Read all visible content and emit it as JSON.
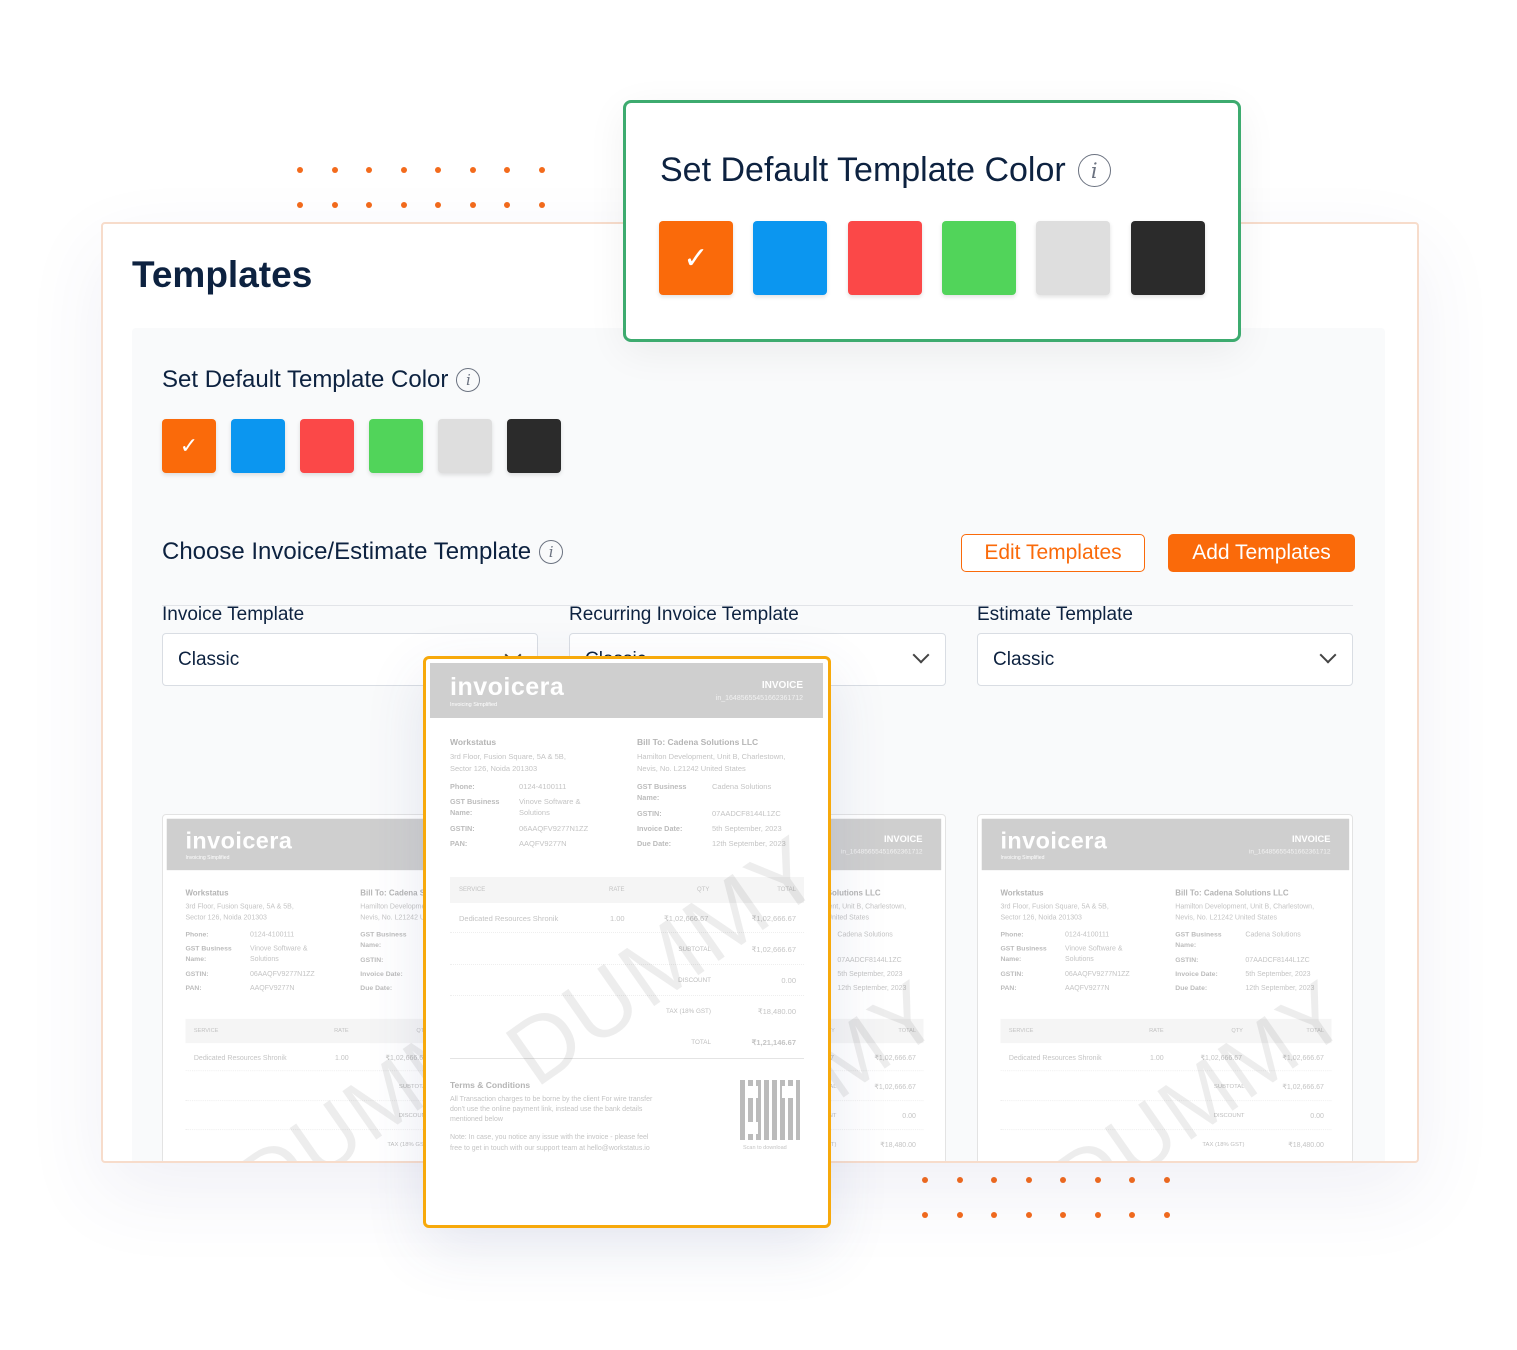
{
  "page": {
    "title": "Templates"
  },
  "color_section": {
    "heading": "Set Default Template Color",
    "info_icon": "info-icon",
    "selected_index": 0,
    "colors": [
      "#fa6a0a",
      "#0b96f0",
      "#fb4848",
      "#51d45a",
      "#dedede",
      "#2b2b2b"
    ]
  },
  "template_section": {
    "heading": "Choose Invoice/Estimate Template",
    "edit_label": "Edit Templates",
    "add_label": "Add Templates",
    "accent": "#fa6a0a",
    "selects": [
      {
        "label": "Invoice Template",
        "value": "Classic"
      },
      {
        "label": "Recurring Invoice Template",
        "value": "Classic"
      },
      {
        "label": "Estimate Template",
        "value": "Classic"
      }
    ]
  },
  "invoice": {
    "logo": "invoicera",
    "tagline": "Invoicing Simplified",
    "doc_type": "INVOICE",
    "number": "in_16485655451662361712",
    "from_name": "Workstatus",
    "from_address": [
      "3rd Floor, Fusion Square, 5A & 5B,",
      "Sector 126, Noida 201303"
    ],
    "from_fields": [
      {
        "k": "Phone:",
        "v": "0124-4100111"
      },
      {
        "k": "GST Business Name:",
        "v": "Vinove Software & Solutions"
      },
      {
        "k": "GSTIN:",
        "v": "06AAQFV9277N1ZZ"
      },
      {
        "k": "PAN:",
        "v": "AAQFV9277N"
      }
    ],
    "bill_to": "Bill To: Cadena Solutions LLC",
    "to_address": [
      "Hamilton Development, Unit B, Charlestown,",
      "Nevis, No. L21242 United States"
    ],
    "to_fields": [
      {
        "k": "GST Business Name:",
        "v": "Cadena Solutions"
      },
      {
        "k": "GSTIN:",
        "v": "07AADCF8144L1ZC"
      },
      {
        "k": "Invoice Date:",
        "v": "5th September, 2023"
      },
      {
        "k": "Due Date:",
        "v": "12th September, 2023"
      }
    ],
    "columns": [
      "SERVICE",
      "RATE",
      "QTY",
      "TOTAL"
    ],
    "row": {
      "service": "Dedicated Resources Shronik",
      "rate": "1.00",
      "qty": "₹1,02,666.67",
      "total": "₹1,02,666.67"
    },
    "summary": [
      {
        "k": "SUBTOTAL",
        "v": "₹1,02,666.67"
      },
      {
        "k": "DISCOUNT",
        "v": "0.00"
      },
      {
        "k": "TAX (18% GST)",
        "v": "₹18,480.00"
      },
      {
        "k": "TOTAL",
        "v": "₹1,21,146.67"
      }
    ],
    "terms_title": "Terms & Conditions",
    "terms_text": [
      "All Transaction charges to be borne by the client For wire transfer",
      "don't use the online payment link, instead use the bank details",
      "mentioned below"
    ],
    "note": [
      "Note: In case, you notice any issue with the invoice - please feel",
      "free to get in touch with our support team at hello@workstatus.io"
    ],
    "qr_caption": "Scan to download",
    "watermark": "DUMMY"
  }
}
